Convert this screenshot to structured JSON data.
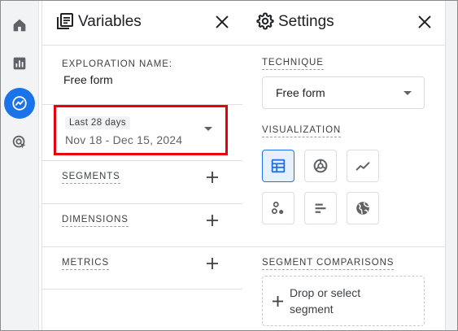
{
  "rail": {
    "items": [
      {
        "icon": "home-icon",
        "active": false
      },
      {
        "icon": "reports-icon",
        "active": false
      },
      {
        "icon": "explore-icon",
        "active": true
      },
      {
        "icon": "advertising-icon",
        "active": false
      }
    ]
  },
  "variables": {
    "title": "Variables",
    "exploration_name_label": "EXPLORATION NAME:",
    "exploration_name_value": "Free form",
    "date_chip": "Last 28 days",
    "date_range": "Nov 18 - Dec 15, 2024",
    "segments_label": "SEGMENTS",
    "dimensions_label": "DIMENSIONS",
    "metrics_label": "METRICS"
  },
  "settings": {
    "title": "Settings",
    "technique_label": "TECHNIQUE",
    "technique_value": "Free form",
    "visualization_label": "VISUALIZATION",
    "visualizations": [
      {
        "icon": "table-icon",
        "selected": true
      },
      {
        "icon": "donut-chart-icon",
        "selected": false
      },
      {
        "icon": "line-chart-icon",
        "selected": false
      },
      {
        "icon": "scatter-plot-icon",
        "selected": false
      },
      {
        "icon": "bar-chart-icon",
        "selected": false
      },
      {
        "icon": "geo-map-icon",
        "selected": false
      }
    ],
    "segment_comparisons_label": "SEGMENT COMPARISONS",
    "drop_segment_text": "Drop or select segment"
  },
  "colors": {
    "accent": "#1a73e8",
    "highlight_border": "#e8000b",
    "icon_grey": "#5f6368"
  }
}
